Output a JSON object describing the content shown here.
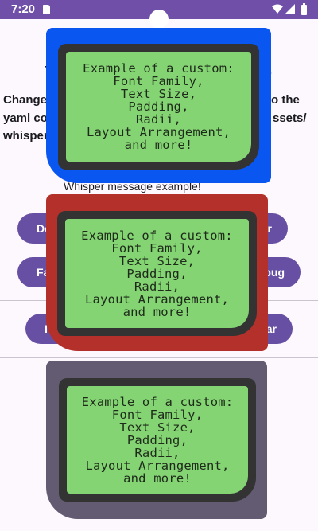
{
  "status_bar": {
    "time": "7:20",
    "icons": [
      "sd-card-icon",
      "wifi-icon",
      "signal-icon",
      "battery-icon"
    ],
    "color": "#6f4fa8"
  },
  "background": {
    "instruction_line_1_start": "T",
    "instruction_line_1_end": ".",
    "instruction_line_2_start": "Change",
    "instruction_line_2_end": "o the",
    "instruction_line_3_start": "yaml co",
    "instruction_line_3_end": "ssets/",
    "instruction_line_4_start": "whisper",
    "whisper_label_partial": "Whisper message example!",
    "buttons_row1": {
      "left": "De",
      "right": "r"
    },
    "buttons_row2": {
      "left": "Fa",
      "right": "oug"
    },
    "buttons_row3": {
      "left": "I",
      "right": "ar"
    }
  },
  "popups": [
    {
      "text": "Example of a custom:\nFont Family,\nText Size,\nPadding,\nRadii,\nLayout Arrangement,\nand more!",
      "bg_color": "#0a56f0"
    },
    {
      "text": "Example of a custom:\nFont Family,\nText Size,\nPadding,\nRadii,\nLayout Arrangement,\nand more!",
      "bg_color": "#b3312a"
    },
    {
      "text": "Example of a custom:\nFont Family,\nText Size,\nPadding,\nRadii,\nLayout Arrangement,\nand more!",
      "bg_color": "#625b71"
    }
  ],
  "colors": {
    "lcd_green": "#84d474",
    "lcd_frame": "#333333",
    "accent": "#6750a4"
  }
}
